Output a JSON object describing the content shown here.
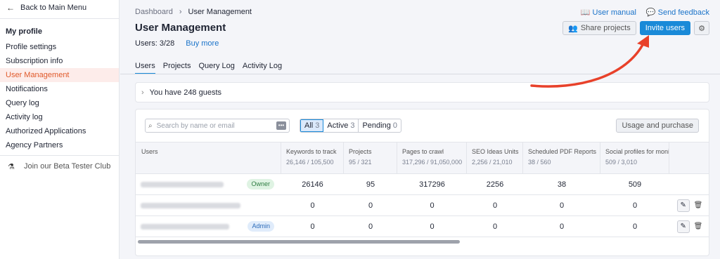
{
  "sidebar": {
    "back_label": "Back to Main Menu",
    "section_title": "My profile",
    "items": [
      {
        "label": "Profile settings",
        "active": false
      },
      {
        "label": "Subscription info",
        "active": false
      },
      {
        "label": "User Management",
        "active": true
      },
      {
        "label": "Notifications",
        "active": false
      },
      {
        "label": "Query log",
        "active": false
      },
      {
        "label": "Activity log",
        "active": false
      },
      {
        "label": "Authorized Applications",
        "active": false
      },
      {
        "label": "Agency Partners",
        "active": false
      }
    ],
    "beta_label": "Join our Beta Tester Club"
  },
  "header": {
    "breadcrumb": [
      "Dashboard",
      "User Management"
    ],
    "title": "User Management",
    "users_count": "Users: 3/28",
    "buy_more": "Buy more",
    "user_manual": "User manual",
    "send_feedback": "Send feedback",
    "share_projects": "Share projects",
    "invite_users": "Invite users"
  },
  "tabs": [
    {
      "label": "Users",
      "active": true
    },
    {
      "label": "Projects",
      "active": false
    },
    {
      "label": "Query Log",
      "active": false
    },
    {
      "label": "Activity Log",
      "active": false
    }
  ],
  "guests_text": "You have 248 guests",
  "search": {
    "placeholder": "Search by name or email"
  },
  "filters": [
    {
      "label": "All",
      "count": "3",
      "selected": true
    },
    {
      "label": "Active",
      "count": "3",
      "selected": false
    },
    {
      "label": "Pending",
      "count": "0",
      "selected": false
    }
  ],
  "usage_button": "Usage and purchase",
  "table": {
    "headers": [
      {
        "label": "Users",
        "sub": ""
      },
      {
        "label": "Keywords to track",
        "sub": "26,146 / 105,500"
      },
      {
        "label": "Projects",
        "sub": "95 / 321"
      },
      {
        "label": "Pages to crawl",
        "sub": "317,296 / 91,050,000"
      },
      {
        "label": "SEO Ideas Units",
        "sub": "2,256 / 21,010"
      },
      {
        "label": "Scheduled PDF Reports",
        "sub": "38 / 560"
      },
      {
        "label": "Social profiles for monitoring",
        "sub": "509 / 3,010"
      }
    ],
    "rows": [
      {
        "role": "Owner",
        "values": [
          "26146",
          "95",
          "317296",
          "2256",
          "38",
          "509"
        ],
        "actions": false
      },
      {
        "role": "",
        "values": [
          "0",
          "0",
          "0",
          "0",
          "0",
          "0"
        ],
        "actions": true
      },
      {
        "role": "Admin",
        "values": [
          "0",
          "0",
          "0",
          "0",
          "0",
          "0"
        ],
        "actions": true
      }
    ]
  },
  "colors": {
    "accent": "#1a8ad8",
    "active_nav": "#e05a2b",
    "arrow": "#e8412a"
  }
}
